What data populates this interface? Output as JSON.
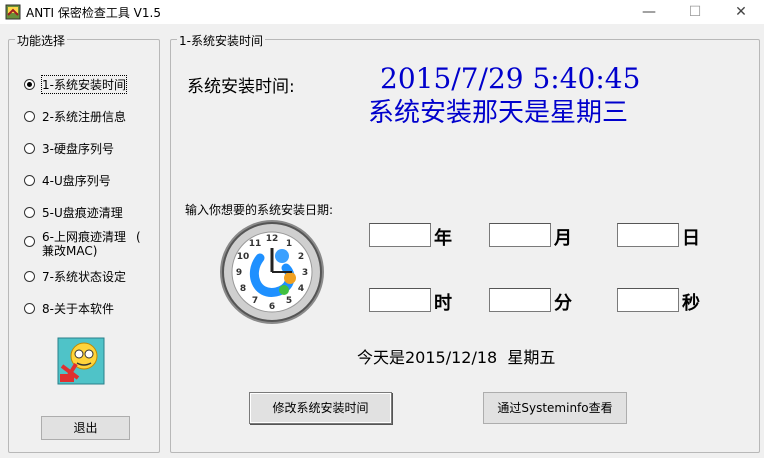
{
  "window": {
    "title": "ANTI 保密检查工具 V1.5",
    "min_glyph": "—",
    "max_glyph": "☐",
    "close_glyph": "✕"
  },
  "left_panel": {
    "legend": "功能选择",
    "items": [
      {
        "label": "1-系统安装时间",
        "checked": true
      },
      {
        "label": "2-系统注册信息",
        "checked": false
      },
      {
        "label": "3-硬盘序列号",
        "checked": false
      },
      {
        "label": "4-U盘序列号",
        "checked": false
      },
      {
        "label": "5-U盘痕迹清理",
        "checked": false
      },
      {
        "label": "6-上网痕迹清理",
        "label_line2": "兼改MAC)",
        "extra": "(",
        "checked": false
      },
      {
        "label": "7-系统状态设定",
        "checked": false
      },
      {
        "label": "8-关于本软件",
        "checked": false
      }
    ],
    "exit_button": "退出"
  },
  "main_panel": {
    "legend": "1-系统安装时间",
    "install_label": "系统安装时间:",
    "install_datetime": "2015/7/29 5:40:45",
    "install_weekday": "系统安装那天是星期三",
    "input_prompt": "输入你想要的系统安装日期:",
    "units": {
      "year": "年",
      "month": "月",
      "day": "日",
      "hour": "时",
      "minute": "分",
      "second": "秒"
    },
    "today_text": "今天是2015/12/18  星期五",
    "modify_button": "修改系统安装时间",
    "systeminfo_button": "通过Systeminfo查看"
  },
  "colors": {
    "accent_text": "#0000cc",
    "window_bg": "#f0f0f0"
  },
  "icons": [
    "app-icon",
    "clock-icon",
    "face-logo-icon"
  ]
}
